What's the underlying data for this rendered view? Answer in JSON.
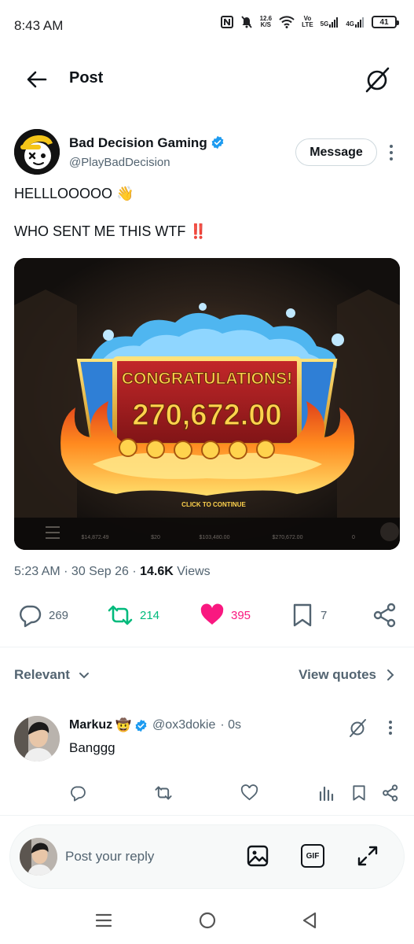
{
  "status": {
    "time": "8:43 AM",
    "speed_top": "12.6",
    "speed_unit": "K/S",
    "volte_top": "Vo",
    "volte_bottom": "LTE",
    "net1": "5G",
    "net2": "4G",
    "battery": "41"
  },
  "topbar": {
    "title": "Post"
  },
  "post": {
    "author_name": "Bad Decision Gaming",
    "author_handle": "@PlayBadDecision",
    "message_button": "Message",
    "line1": "HELLLOOOOO 👋",
    "line2": "WHO SENT ME THIS WTF ‼️",
    "media": {
      "congrats": "CONGRATULATIONS!",
      "amount": "270,672.00",
      "click": "CLICK TO CONTINUE",
      "hud": [
        "$14,872.49",
        "$20",
        "$103,480.00",
        "$270,672.00",
        "0"
      ]
    },
    "time": "5:23 AM",
    "date": "30 Sep 26",
    "views_count": "14.6K",
    "views_label": "Views",
    "replies": "269",
    "reposts": "214",
    "likes": "395",
    "bookmarks": "7",
    "colors": {
      "repost": "#00ba7c",
      "like": "#f91880",
      "verified": "#1d9bf0"
    }
  },
  "sort": {
    "label": "Relevant",
    "view_quotes": "View quotes"
  },
  "reply": {
    "name": "Markuz",
    "emoji": "🤠",
    "handle": "@ox3dokie",
    "time": "· 0s",
    "text": "Banggg"
  },
  "composer": {
    "placeholder": "Post your reply",
    "gif": "GIF"
  }
}
